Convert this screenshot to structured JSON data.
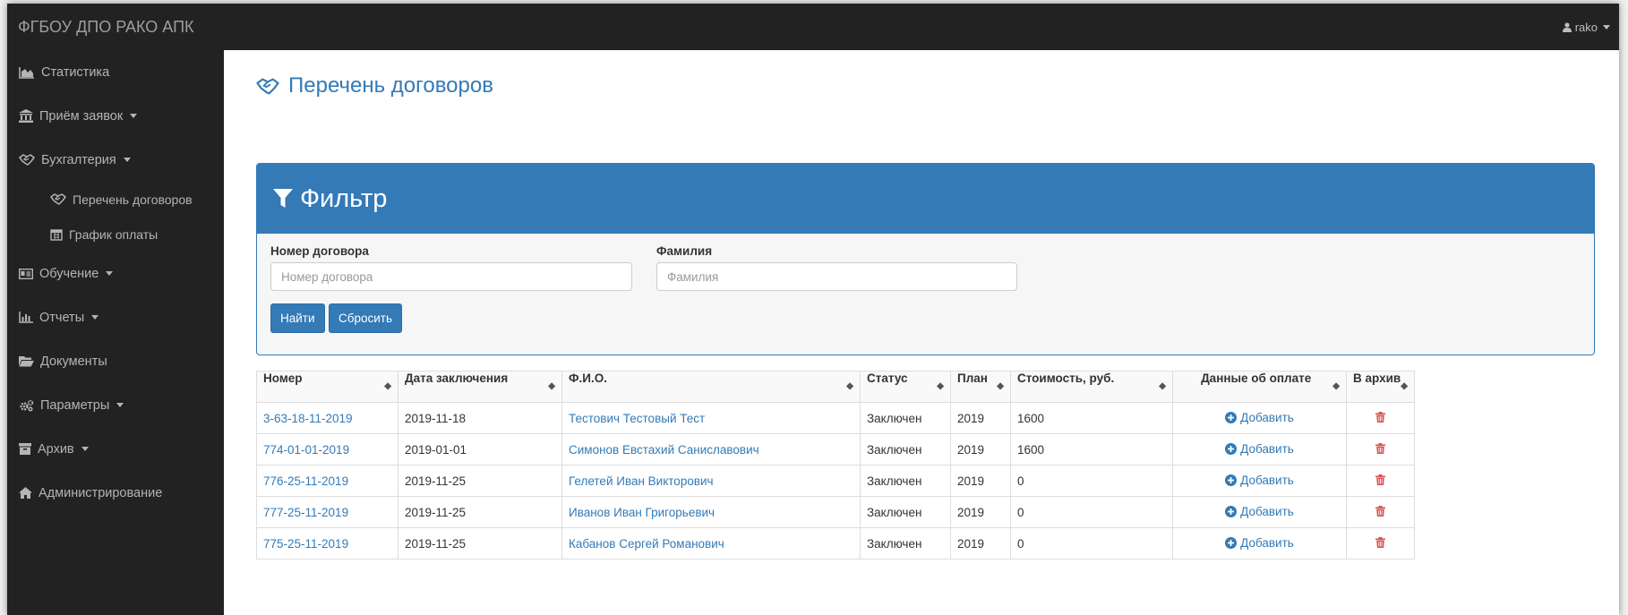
{
  "brand": "ФГБОУ ДПО РАКО АПК",
  "user": "rako",
  "sidebar": {
    "items": [
      {
        "label": "Статистика"
      },
      {
        "label": "Приём заявок"
      },
      {
        "label": "Бухгалтерия"
      },
      {
        "label": "Перечень договоров"
      },
      {
        "label": "График оплаты"
      },
      {
        "label": "Обучение"
      },
      {
        "label": "Отчеты"
      },
      {
        "label": "Документы"
      },
      {
        "label": "Параметры"
      },
      {
        "label": "Архив"
      },
      {
        "label": "Администрирование"
      }
    ]
  },
  "page": {
    "title": "Перечень договоров"
  },
  "filter": {
    "title": "Фильтр",
    "number_label": "Номер договора",
    "number_placeholder": "Номер договора",
    "surname_label": "Фамилия",
    "surname_placeholder": "Фамилия",
    "find_button": "Найти",
    "reset_button": "Сбросить"
  },
  "table": {
    "headers": [
      "Номер",
      "Дата заключения",
      "Ф.И.О.",
      "Статус",
      "План",
      "Стоимость, руб.",
      "Данные об оплате",
      "В архив"
    ],
    "add_label": "Добавить",
    "rows": [
      {
        "number": "3-63-18-11-2019",
        "date": "2019-11-18",
        "name": "Тестович Тестовый Тест",
        "status": "Заключен",
        "plan": "2019",
        "cost": "1600"
      },
      {
        "number": "774-01-01-2019",
        "date": "2019-01-01",
        "name": "Симонов Евстахий Саниславович",
        "status": "Заключен",
        "plan": "2019",
        "cost": "1600"
      },
      {
        "number": "776-25-11-2019",
        "date": "2019-11-25",
        "name": "Гелетей Иван Викторович",
        "status": "Заключен",
        "plan": "2019",
        "cost": "0"
      },
      {
        "number": "777-25-11-2019",
        "date": "2019-11-25",
        "name": "Иванов Иван Григорьевич",
        "status": "Заключен",
        "plan": "2019",
        "cost": "0"
      },
      {
        "number": "775-25-11-2019",
        "date": "2019-11-25",
        "name": "Кабанов Сергей Романович",
        "status": "Заключен",
        "plan": "2019",
        "cost": "0"
      }
    ]
  },
  "colors": {
    "primary": "#337ab7",
    "navbar": "#222222",
    "danger": "#d9534f"
  }
}
